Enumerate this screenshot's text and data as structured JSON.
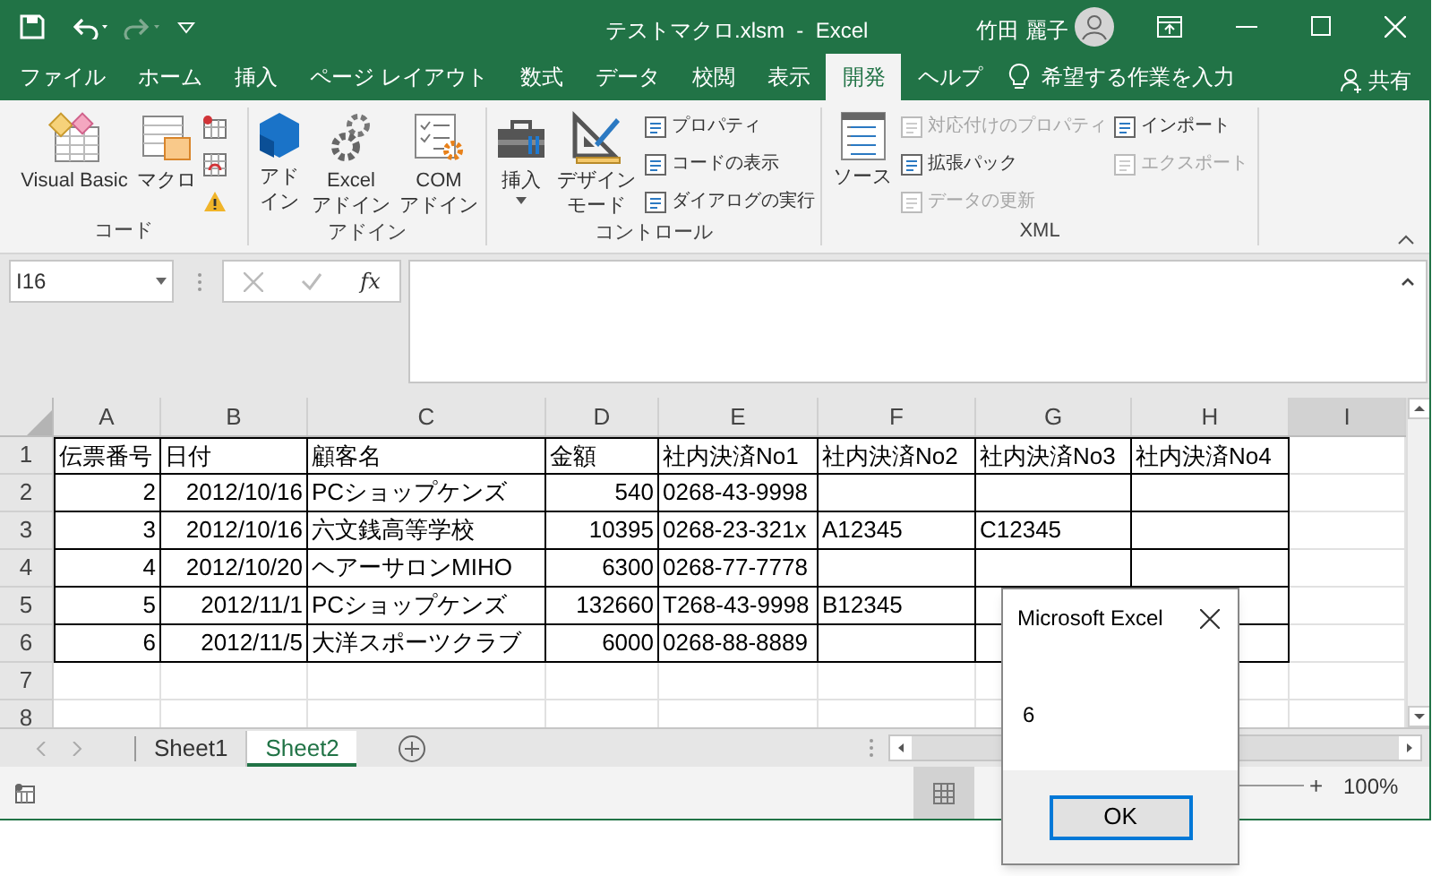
{
  "title_bar": {
    "title": "テストマクロ.xlsm  -  Excel",
    "user": "竹田 麗子"
  },
  "ribbon_tabs": [
    {
      "label": "ファイル",
      "selected": false
    },
    {
      "label": "ホーム",
      "selected": false
    },
    {
      "label": "挿入",
      "selected": false
    },
    {
      "label": "ページ レイアウト",
      "selected": false
    },
    {
      "label": "数式",
      "selected": false
    },
    {
      "label": "データ",
      "selected": false
    },
    {
      "label": "校閲",
      "selected": false
    },
    {
      "label": "表示",
      "selected": false
    },
    {
      "label": "開発",
      "selected": true
    },
    {
      "label": "ヘルプ",
      "selected": false
    }
  ],
  "tell_me": {
    "placeholder": "希望する作業を入力"
  },
  "share": "共有",
  "ribbon_groups": [
    {
      "label": "コード",
      "items": [
        {
          "kind": "large",
          "label": "Visual Basic"
        },
        {
          "kind": "large",
          "label": "マクロ"
        },
        {
          "kind": "small"
        },
        {
          "kind": "small"
        },
        {
          "kind": "small"
        }
      ]
    },
    {
      "label": "アドイン",
      "items": [
        {
          "kind": "large",
          "lines": [
            "アド",
            "イン"
          ]
        },
        {
          "kind": "large",
          "lines": [
            "Excel",
            "アドイン"
          ]
        },
        {
          "kind": "large",
          "lines": [
            "COM",
            "アドイン"
          ]
        }
      ]
    },
    {
      "label": "コントロール",
      "items": [
        {
          "kind": "large",
          "label": "挿入",
          "dropdown": true
        },
        {
          "kind": "large",
          "lines": [
            "デザイン",
            "モード"
          ]
        },
        {
          "kind": "small",
          "label": "プロパティ",
          "disabled": false
        },
        {
          "kind": "small",
          "label": "コードの表示",
          "disabled": false
        },
        {
          "kind": "small",
          "label": "ダイアログの実行",
          "disabled": false
        }
      ]
    },
    {
      "label": "XML",
      "items": [
        {
          "kind": "large",
          "label": "ソース"
        },
        {
          "kind": "small",
          "label": "対応付けのプロパティ",
          "disabled": true
        },
        {
          "kind": "small",
          "label": "拡張パック",
          "disabled": false
        },
        {
          "kind": "small",
          "label": "データの更新",
          "disabled": true
        },
        {
          "kind": "small",
          "label": "インポート",
          "disabled": false
        },
        {
          "kind": "small",
          "label": "エクスポート",
          "disabled": true
        }
      ]
    }
  ],
  "name_box": {
    "value": "I16"
  },
  "formula_bar": {
    "function_label": "fx"
  },
  "columns": [
    {
      "label": "A",
      "selected": false
    },
    {
      "label": "B",
      "selected": false
    },
    {
      "label": "C",
      "selected": false
    },
    {
      "label": "D",
      "selected": false
    },
    {
      "label": "E",
      "selected": false
    },
    {
      "label": "F",
      "selected": false
    },
    {
      "label": "G",
      "selected": false
    },
    {
      "label": "H",
      "selected": false
    },
    {
      "label": "I",
      "selected": true
    }
  ],
  "rows": [
    {
      "number": "1",
      "cells": [
        {
          "kind": "text",
          "text": "伝票番号"
        },
        {
          "kind": "text",
          "text": "日付"
        },
        {
          "kind": "text",
          "text": "顧客名"
        },
        {
          "kind": "text",
          "text": "金額"
        },
        {
          "kind": "text",
          "text": "社内決済No1"
        },
        {
          "kind": "text",
          "text": "社内決済No2"
        },
        {
          "kind": "text",
          "text": "社内決済No3"
        },
        {
          "kind": "text",
          "text": "社内決済No4"
        }
      ]
    },
    {
      "number": "2",
      "cells": [
        {
          "kind": "number",
          "text": "2"
        },
        {
          "kind": "number",
          "text": "2012/10/16"
        },
        {
          "kind": "text",
          "text": "PCショップケンズ"
        },
        {
          "kind": "number",
          "text": "540"
        },
        {
          "kind": "text",
          "text": "0268-43-9998"
        },
        {
          "kind": "empty"
        },
        {
          "kind": "empty"
        },
        {
          "kind": "empty"
        }
      ]
    },
    {
      "number": "3",
      "cells": [
        {
          "kind": "number",
          "text": "3"
        },
        {
          "kind": "number",
          "text": "2012/10/16"
        },
        {
          "kind": "text",
          "text": "六文銭高等学校"
        },
        {
          "kind": "number",
          "text": "10395"
        },
        {
          "kind": "text",
          "text": "0268-23-321x"
        },
        {
          "kind": "text",
          "text": "A12345"
        },
        {
          "kind": "text",
          "text": "C12345"
        },
        {
          "kind": "empty"
        }
      ]
    },
    {
      "number": "4",
      "cells": [
        {
          "kind": "number",
          "text": "4"
        },
        {
          "kind": "number",
          "text": "2012/10/20"
        },
        {
          "kind": "text",
          "text": "ヘアーサロンMIHO"
        },
        {
          "kind": "number",
          "text": "6300"
        },
        {
          "kind": "text",
          "text": "0268-77-7778"
        },
        {
          "kind": "empty"
        },
        {
          "kind": "empty"
        },
        {
          "kind": "empty"
        }
      ]
    },
    {
      "number": "5",
      "cells": [
        {
          "kind": "number",
          "text": "5"
        },
        {
          "kind": "number",
          "text": "2012/11/1"
        },
        {
          "kind": "text",
          "text": "PCショップケンズ"
        },
        {
          "kind": "number",
          "text": "132660"
        },
        {
          "kind": "text",
          "text": "T268-43-9998"
        },
        {
          "kind": "text",
          "text": "B12345"
        },
        {
          "kind": "empty"
        },
        {
          "kind": "empty"
        }
      ]
    },
    {
      "number": "6",
      "cells": [
        {
          "kind": "number",
          "text": "6"
        },
        {
          "kind": "number",
          "text": "2012/11/5"
        },
        {
          "kind": "text",
          "text": "大洋スポーツクラブ"
        },
        {
          "kind": "number",
          "text": "6000"
        },
        {
          "kind": "text",
          "text": "0268-88-8889"
        },
        {
          "kind": "empty"
        },
        {
          "kind": "empty"
        },
        {
          "kind": "empty"
        }
      ]
    },
    {
      "number": "7"
    },
    {
      "number": "8"
    }
  ],
  "sheet_tabs": [
    {
      "label": "Sheet1",
      "selected": false
    },
    {
      "label": "Sheet2",
      "selected": true
    }
  ],
  "status_bar": {
    "zoom_in": "+",
    "zoom": "100%"
  },
  "dialog": {
    "title": "Microsoft Excel",
    "message": "6",
    "button": "OK"
  }
}
